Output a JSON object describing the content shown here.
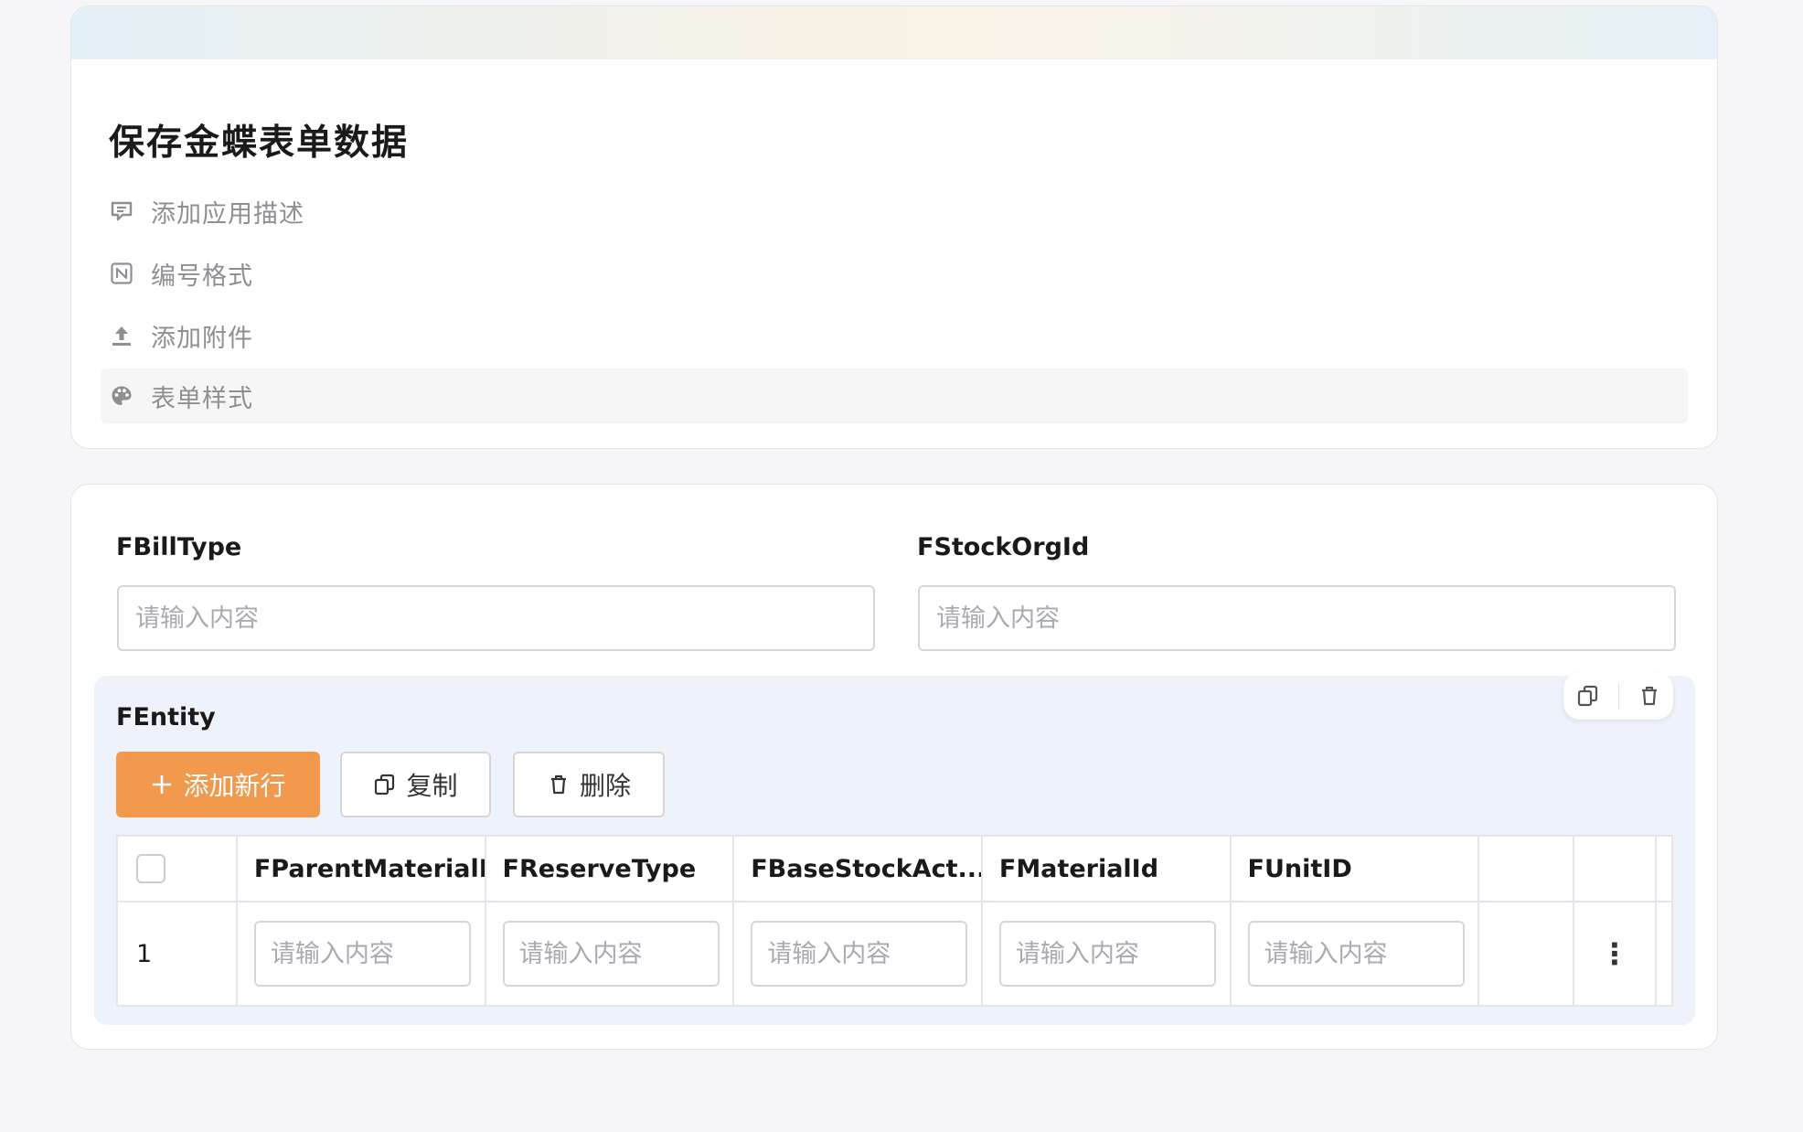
{
  "form": {
    "title": "保存金蝶表单数据",
    "meta_items": [
      {
        "label": "添加应用描述",
        "icon": "comment-icon"
      },
      {
        "label": "编号格式",
        "icon": "numbering-icon"
      },
      {
        "label": "添加附件",
        "icon": "upload-icon"
      },
      {
        "label": "表单样式",
        "icon": "palette-icon"
      }
    ]
  },
  "fields": {
    "bill_type": {
      "label": "FBillType",
      "placeholder": "请输入内容",
      "value": ""
    },
    "stock_org": {
      "label": "FStockOrgId",
      "placeholder": "请输入内容",
      "value": ""
    }
  },
  "entity": {
    "title": "FEntity",
    "add_row_label": "添加新行",
    "copy_label": "复制",
    "delete_label": "删除",
    "columns": [
      "FParentMaterialId",
      "FReserveType",
      "FBaseStockAct...",
      "FMaterialId",
      "FUnitID"
    ],
    "rows": [
      {
        "index": "1",
        "placeholder": "请输入内容"
      }
    ]
  },
  "colors": {
    "accent": "#f19a4d",
    "entity_background": "#eef2fb",
    "muted_text": "#8e8e93"
  }
}
